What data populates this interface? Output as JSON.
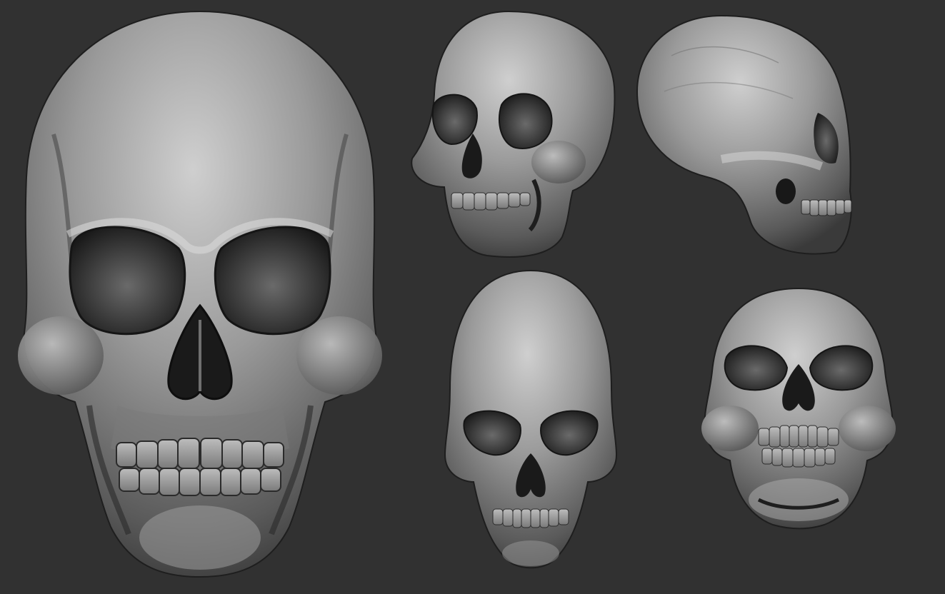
{
  "viewport": {
    "background": "#313131",
    "material": {
      "light": "#c9c9c9",
      "mid": "#8a8a8a",
      "dark": "#2a2a2a",
      "cavity": "#161616"
    }
  },
  "renders": [
    {
      "id": "front-large",
      "view": "front"
    },
    {
      "id": "three-quarter",
      "view": "three-quarter"
    },
    {
      "id": "side",
      "view": "side"
    },
    {
      "id": "front-top",
      "view": "front-from-above"
    },
    {
      "id": "front-below",
      "view": "front-from-below"
    }
  ]
}
